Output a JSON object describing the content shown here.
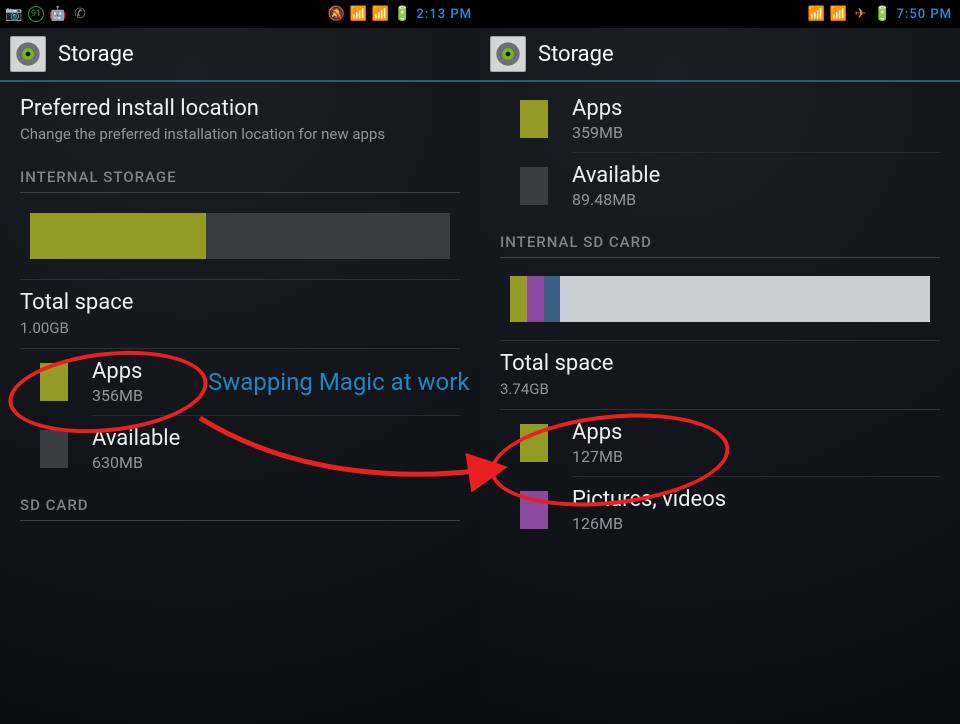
{
  "left": {
    "status": {
      "time": "2:13 PM",
      "badge": "91"
    },
    "title": "Storage",
    "pref": {
      "title": "Preferred install location",
      "sub": "Change the preferred installation location for new apps"
    },
    "section1": "INTERNAL STORAGE",
    "bar": {
      "segments": [
        {
          "color": "#939a26",
          "width": 42
        }
      ],
      "bg": "#3a3e42"
    },
    "total": {
      "label": "Total space",
      "value": "1.00GB"
    },
    "legend": [
      {
        "color": "#939a26",
        "label": "Apps",
        "value": "356MB"
      },
      {
        "color": "#3a3e42",
        "label": "Available",
        "value": "630MB"
      }
    ],
    "section2": "SD CARD"
  },
  "right": {
    "status": {
      "time": "7:50 PM"
    },
    "title": "Storage",
    "legend_top": [
      {
        "color": "#939a26",
        "label": "Apps",
        "value": "359MB"
      },
      {
        "color": "#3a3e42",
        "label": "Available",
        "value": "89.48MB"
      }
    ],
    "section1": "INTERNAL SD CARD",
    "bar": {
      "segments": [
        {
          "color": "#939a26",
          "width": 4
        },
        {
          "color": "#8b4a9e",
          "width": 4
        },
        {
          "color": "#3c5f86",
          "width": 4
        }
      ],
      "bg": "#c9cfd3"
    },
    "total": {
      "label": "Total space",
      "value": "3.74GB"
    },
    "legend_bottom": [
      {
        "color": "#939a26",
        "label": "Apps",
        "value": "127MB"
      },
      {
        "color": "#8b4a9e",
        "label": "Pictures, videos",
        "value": "126MB"
      }
    ]
  },
  "annotation": {
    "text": "Swapping Magic at work"
  }
}
